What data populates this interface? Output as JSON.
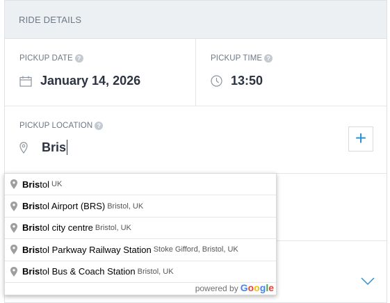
{
  "section": {
    "title": "RIDE DETAILS"
  },
  "pickup_date": {
    "label": "PICKUP DATE",
    "value": "January 14, 2026",
    "help": "?"
  },
  "pickup_time": {
    "label": "PICKUP TIME",
    "value": "13:50",
    "help": "?"
  },
  "pickup_location": {
    "label": "PICKUP LOCATION",
    "value": "Bris",
    "help": "?",
    "add_label": "+"
  },
  "autocomplete": {
    "items": [
      {
        "match": "Bris",
        "rest": "tol",
        "secondary": "UK"
      },
      {
        "match": "Bris",
        "rest": "tol Airport (BRS)",
        "secondary": "Bristol, UK"
      },
      {
        "match": "Bris",
        "rest": "tol city centre",
        "secondary": "Bristol, UK"
      },
      {
        "match": "Bris",
        "rest": "tol Parkway Railway Station",
        "secondary": "Stoke Gifford, Bristol, UK"
      },
      {
        "match": "Bris",
        "rest": "tol Bus & Coach Station",
        "secondary": "Bristol, UK"
      }
    ],
    "powered_by": "powered by",
    "google_letters": [
      {
        "ch": "G",
        "color": "#4285F4"
      },
      {
        "ch": "o",
        "color": "#EA4335"
      },
      {
        "ch": "o",
        "color": "#FBBC05"
      },
      {
        "ch": "g",
        "color": "#4285F4"
      },
      {
        "ch": "l",
        "color": "#34A853"
      },
      {
        "ch": "e",
        "color": "#EA4335"
      }
    ]
  },
  "colors": {
    "accent": "#2a8fd3",
    "header_bg": "#edf0f3"
  }
}
